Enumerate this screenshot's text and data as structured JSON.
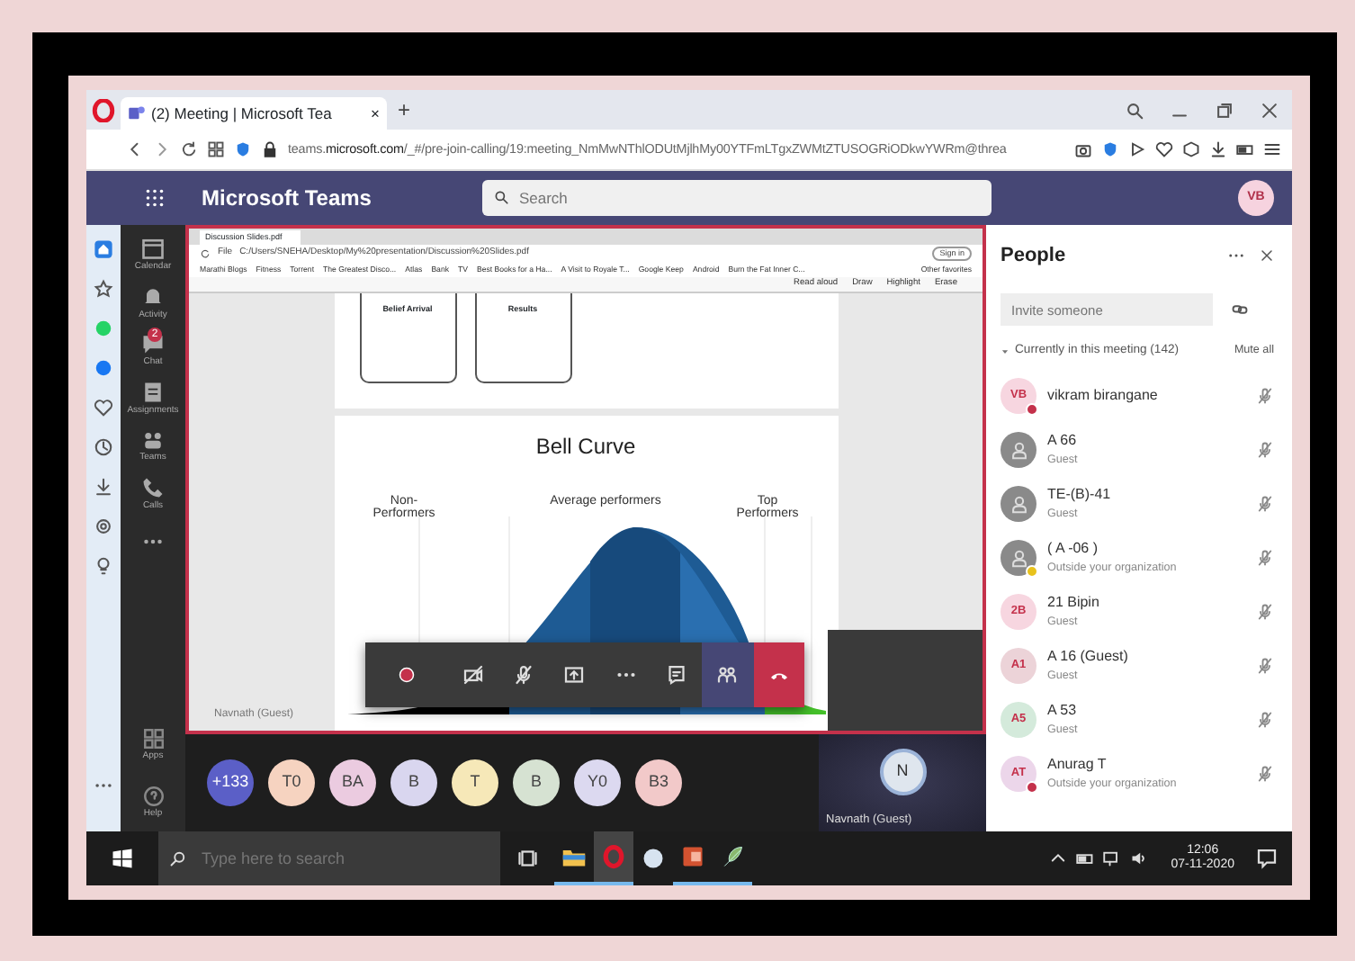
{
  "browser": {
    "tab_title": "(2) Meeting | Microsoft Tea",
    "tab_close": "×",
    "new_tab": "+",
    "url": "teams.**microsoft.com**/_#/pre-join-calling/19:meeting_NmMwNThlODUtMjlhMy00YTFmLTgxZWMtZTUSOGRiODkwYWRm@threa"
  },
  "teams_header": {
    "app_name": "Microsoft Teams",
    "search_placeholder": "Search",
    "user_initials": "VB"
  },
  "rail": [
    {
      "label": "Calendar"
    },
    {
      "label": "Activity"
    },
    {
      "label": "Chat",
      "badge": "2"
    },
    {
      "label": "Assignments"
    },
    {
      "label": "Teams"
    },
    {
      "label": "Calls"
    }
  ],
  "rail_bottom": [
    {
      "label": "Apps"
    },
    {
      "label": "Help"
    }
  ],
  "shared_screen": {
    "tab_title": "Discussion Slides.pdf",
    "file_label": "File",
    "path": "C:/Users/SNEHA/Desktop/My%20presentation/Discussion%20Slides.pdf",
    "sign_in": "Sign in",
    "bookmarks": [
      "Marathi Blogs",
      "Fitness",
      "Torrent",
      "The Greatest Disco...",
      "Atlas",
      "Bank",
      "TV",
      "Best Books for a Ha...",
      "A Visit to Royale T...",
      "Google Keep",
      "Android",
      "Burn the Fat Inner C..."
    ],
    "other_favorites": "Other favorites",
    "pdf_tools": [
      "Read aloud",
      "Draw",
      "Highlight",
      "Erase"
    ],
    "slide_cards": [
      "Belief Arrival",
      "Results"
    ],
    "bell_curve": {
      "title": "Bell Curve",
      "segments": [
        "Non-Performers",
        "Average performers",
        "Top Performers"
      ]
    },
    "presenter_label": "Navnath (Guest)"
  },
  "call_controls": [
    {
      "kind": "record",
      "selected": false
    },
    {
      "kind": "camera",
      "selected": false,
      "off": true
    },
    {
      "kind": "mic",
      "selected": false,
      "off": true
    },
    {
      "kind": "share",
      "selected": false
    },
    {
      "kind": "more",
      "selected": false
    },
    {
      "kind": "chat",
      "selected": false
    },
    {
      "kind": "people",
      "selected": true
    },
    {
      "kind": "hangup",
      "selected": false
    }
  ],
  "participant_strip": [
    {
      "initials": "+133",
      "color": "#5b5fc7"
    },
    {
      "initials": "T0",
      "color": "#f6d3c0"
    },
    {
      "initials": "BA",
      "color": "#ebcbe0"
    },
    {
      "initials": "B",
      "color": "#d9d6ef"
    },
    {
      "initials": "T",
      "color": "#f6e8b8"
    },
    {
      "initials": "B",
      "color": "#d6e2d2"
    },
    {
      "initials": "Y0",
      "color": "#dcd9f0"
    },
    {
      "initials": "B3",
      "color": "#f2c9c9"
    }
  ],
  "spotlight": {
    "initial": "N",
    "name": "Navnath (Guest)"
  },
  "people_panel": {
    "title": "People",
    "invite_placeholder": "Invite someone",
    "section": "Currently in this meeting (142)",
    "expanded": true,
    "mute_all": "Mute all",
    "participants": [
      {
        "name": "vikram birangane",
        "avatar": {
          "kind": "initials",
          "initials": "VB",
          "color": "#f7d6e0"
        },
        "presence": {
          "color": "#c4314b"
        },
        "muted": true
      },
      {
        "name": "A 66",
        "subtitle": "Guest",
        "avatar": {
          "kind": "silhouette"
        },
        "muted": true
      },
      {
        "name": "TE-(B)-41",
        "subtitle": "Guest",
        "avatar": {
          "kind": "silhouette"
        },
        "muted": true
      },
      {
        "name": "( A -06 )",
        "subtitle": "Outside your organization",
        "avatar": {
          "kind": "silhouette"
        },
        "presence": {
          "color": "#e8c21c"
        },
        "muted": true
      },
      {
        "name": "21 Bipin",
        "subtitle": "Guest",
        "avatar": {
          "kind": "initials",
          "initials": "2B",
          "color": "#f7d6e0"
        },
        "muted": true
      },
      {
        "name": "A 16 (Guest)",
        "subtitle": "Guest",
        "avatar": {
          "kind": "initials",
          "initials": "A1",
          "color": "#ecd3d8"
        },
        "muted": true
      },
      {
        "name": "A 53",
        "subtitle": "Guest",
        "avatar": {
          "kind": "initials",
          "initials": "A5",
          "color": "#d4eadb"
        },
        "muted": true
      },
      {
        "name": "Anurag T",
        "subtitle": "Outside your organization",
        "avatar": {
          "kind": "initials",
          "initials": "AT",
          "color": "#ecd6ea"
        },
        "presence": {
          "color": "#c4314b"
        },
        "muted": true
      }
    ]
  },
  "taskbar": {
    "search_placeholder": "Type here to search",
    "time": "12:06",
    "date": "07-11-2020",
    "apps": [
      {
        "kind": "folder",
        "active": false,
        "running": true
      },
      {
        "kind": "opera",
        "active": true,
        "running": true
      },
      {
        "kind": "orb",
        "active": false,
        "running": false
      },
      {
        "kind": "slides",
        "active": false,
        "running": true
      },
      {
        "kind": "feather",
        "active": false,
        "running": true
      }
    ]
  }
}
